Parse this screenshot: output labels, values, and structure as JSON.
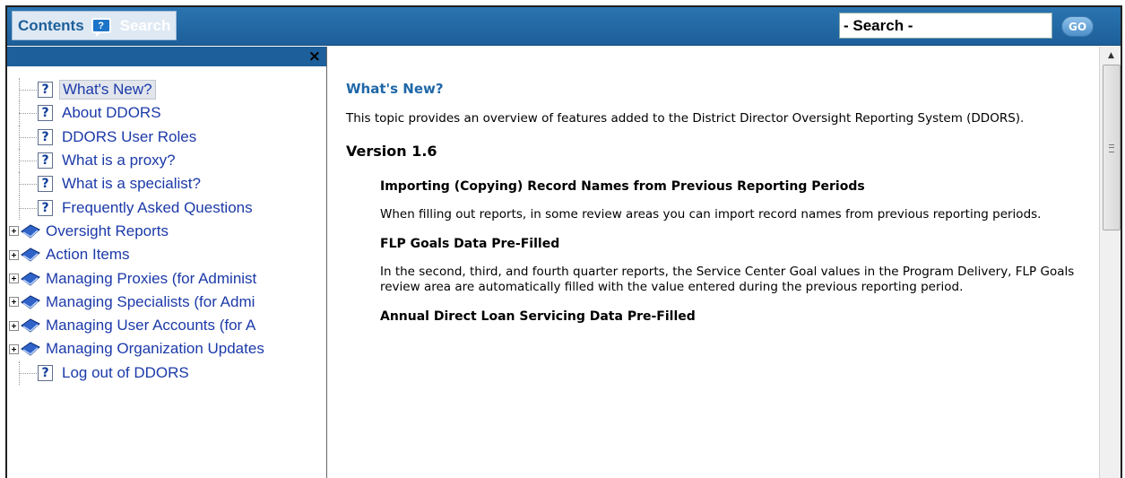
{
  "toolbar": {
    "contents_tab": "Contents",
    "search_tab": "Search",
    "search_value": "- Search -",
    "go_label": "GO"
  },
  "left_pane": {
    "close_glyph": "×",
    "tree": [
      {
        "type": "topic",
        "label": "What's New?",
        "selected": true
      },
      {
        "type": "topic",
        "label": "About DDORS"
      },
      {
        "type": "topic",
        "label": "DDORS User Roles"
      },
      {
        "type": "topic",
        "label": "What is a proxy?"
      },
      {
        "type": "topic",
        "label": "What is a specialist?"
      },
      {
        "type": "topic",
        "label": "Frequently Asked Questions"
      },
      {
        "type": "book",
        "label": "Oversight Reports"
      },
      {
        "type": "book",
        "label": "Action Items"
      },
      {
        "type": "book",
        "label": "Managing Proxies (for Administ"
      },
      {
        "type": "book",
        "label": "Managing Specialists (for Admi"
      },
      {
        "type": "book",
        "label": "Managing User Accounts (for A"
      },
      {
        "type": "book",
        "label": "Managing Organization Updates"
      },
      {
        "type": "topic",
        "label": "Log out of DDORS"
      }
    ]
  },
  "content": {
    "title": "What's New?",
    "intro": "This topic provides an overview of features added to the District Director Oversight Reporting System (DDORS).",
    "version_heading": "Version 1.6",
    "features": [
      {
        "heading": "Importing (Copying) Record Names from Previous Reporting Periods",
        "body": "When filling out reports, in some review areas you can import record names from previous reporting periods."
      },
      {
        "heading": "FLP Goals Data Pre-Filled",
        "body": "In the second, third, and fourth quarter reports, the Service Center Goal values in the Program Delivery, FLP Goals review area are automatically filled with the value entered during the previous reporting period."
      },
      {
        "heading": "Annual Direct Loan Servicing Data Pre-Filled",
        "body": ""
      }
    ]
  },
  "colors": {
    "toolbar": "#1d5f9a",
    "link": "#1c3aa9",
    "title": "#1f67a7"
  }
}
